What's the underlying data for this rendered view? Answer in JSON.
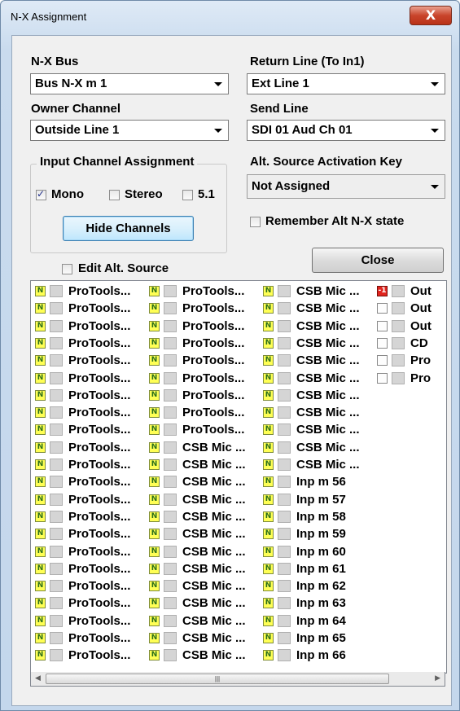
{
  "window": {
    "title": "N-X Assignment",
    "close_glyph": "X"
  },
  "nx_bus": {
    "label": "N-X Bus",
    "value": "Bus N-X m  1"
  },
  "owner_channel": {
    "label": "Owner Channel",
    "value": "Outside Line 1"
  },
  "return_line": {
    "label": "Return Line (To In1)",
    "value": "Ext Line 1"
  },
  "send_line": {
    "label": "Send Line",
    "value": "SDI 01 Aud Ch 01"
  },
  "input_assignment": {
    "title": "Input Channel Assignment",
    "mono": "Mono",
    "mono_checked": true,
    "stereo": "Stereo",
    "stereo_checked": false,
    "surround": "5.1",
    "surround_checked": false,
    "hide_button": "Hide Channels"
  },
  "alt_source_key": {
    "label": "Alt. Source Activation Key",
    "value": "Not Assigned"
  },
  "remember_alt": {
    "label": "Remember Alt N-X state",
    "checked": false
  },
  "edit_alt_source": {
    "label": "Edit Alt. Source",
    "checked": false
  },
  "close_button": "Close",
  "badge_n": "N",
  "badge_r": "-1",
  "channel_columns": [
    {
      "items": [
        {
          "icon": "n",
          "text": "ProTools..."
        },
        {
          "icon": "n",
          "text": "ProTools..."
        },
        {
          "icon": "n",
          "text": "ProTools..."
        },
        {
          "icon": "n",
          "text": "ProTools..."
        },
        {
          "icon": "n",
          "text": "ProTools..."
        },
        {
          "icon": "n",
          "text": "ProTools..."
        },
        {
          "icon": "n",
          "text": "ProTools..."
        },
        {
          "icon": "n",
          "text": "ProTools..."
        },
        {
          "icon": "n",
          "text": "ProTools..."
        },
        {
          "icon": "n",
          "text": "ProTools..."
        },
        {
          "icon": "n",
          "text": "ProTools..."
        },
        {
          "icon": "n",
          "text": "ProTools..."
        },
        {
          "icon": "n",
          "text": "ProTools..."
        },
        {
          "icon": "n",
          "text": "ProTools..."
        },
        {
          "icon": "n",
          "text": "ProTools..."
        },
        {
          "icon": "n",
          "text": "ProTools..."
        },
        {
          "icon": "n",
          "text": "ProTools..."
        },
        {
          "icon": "n",
          "text": "ProTools..."
        },
        {
          "icon": "n",
          "text": "ProTools..."
        },
        {
          "icon": "n",
          "text": "ProTools..."
        },
        {
          "icon": "n",
          "text": "ProTools..."
        },
        {
          "icon": "n",
          "text": "ProTools..."
        }
      ]
    },
    {
      "items": [
        {
          "icon": "n",
          "text": "ProTools..."
        },
        {
          "icon": "n",
          "text": "ProTools..."
        },
        {
          "icon": "n",
          "text": "ProTools..."
        },
        {
          "icon": "n",
          "text": "ProTools..."
        },
        {
          "icon": "n",
          "text": "ProTools..."
        },
        {
          "icon": "n",
          "text": "ProTools..."
        },
        {
          "icon": "n",
          "text": "ProTools..."
        },
        {
          "icon": "n",
          "text": "ProTools..."
        },
        {
          "icon": "n",
          "text": "ProTools..."
        },
        {
          "icon": "n",
          "text": "CSB Mic ..."
        },
        {
          "icon": "n",
          "text": "CSB Mic ..."
        },
        {
          "icon": "n",
          "text": "CSB Mic ..."
        },
        {
          "icon": "n",
          "text": "CSB Mic ..."
        },
        {
          "icon": "n",
          "text": "CSB Mic ..."
        },
        {
          "icon": "n",
          "text": "CSB Mic ..."
        },
        {
          "icon": "n",
          "text": "CSB Mic ..."
        },
        {
          "icon": "n",
          "text": "CSB Mic ..."
        },
        {
          "icon": "n",
          "text": "CSB Mic ..."
        },
        {
          "icon": "n",
          "text": "CSB Mic ..."
        },
        {
          "icon": "n",
          "text": "CSB Mic ..."
        },
        {
          "icon": "n",
          "text": "CSB Mic ..."
        },
        {
          "icon": "n",
          "text": "CSB Mic ..."
        }
      ]
    },
    {
      "items": [
        {
          "icon": "n",
          "text": "CSB Mic ..."
        },
        {
          "icon": "n",
          "text": "CSB Mic ..."
        },
        {
          "icon": "n",
          "text": "CSB Mic ..."
        },
        {
          "icon": "n",
          "text": "CSB Mic ..."
        },
        {
          "icon": "n",
          "text": "CSB Mic ..."
        },
        {
          "icon": "n",
          "text": "CSB Mic ..."
        },
        {
          "icon": "n",
          "text": "CSB Mic ..."
        },
        {
          "icon": "n",
          "text": "CSB Mic ..."
        },
        {
          "icon": "n",
          "text": "CSB Mic ..."
        },
        {
          "icon": "n",
          "text": "CSB Mic ..."
        },
        {
          "icon": "n",
          "text": "CSB Mic ..."
        },
        {
          "icon": "n",
          "text": "Inp m 56"
        },
        {
          "icon": "n",
          "text": "Inp m 57"
        },
        {
          "icon": "n",
          "text": "Inp m 58"
        },
        {
          "icon": "n",
          "text": "Inp m 59"
        },
        {
          "icon": "n",
          "text": "Inp m 60"
        },
        {
          "icon": "n",
          "text": "Inp m 61"
        },
        {
          "icon": "n",
          "text": "Inp m 62"
        },
        {
          "icon": "n",
          "text": "Inp m 63"
        },
        {
          "icon": "n",
          "text": "Inp m 64"
        },
        {
          "icon": "n",
          "text": "Inp m 65"
        },
        {
          "icon": "n",
          "text": "Inp m 66"
        }
      ]
    },
    {
      "items": [
        {
          "icon": "r",
          "text": "Out"
        },
        {
          "icon": "b",
          "text": "Out"
        },
        {
          "icon": "b",
          "text": "Out"
        },
        {
          "icon": "b",
          "text": "CD"
        },
        {
          "icon": "b",
          "text": "Pro"
        },
        {
          "icon": "b",
          "text": "Pro"
        }
      ]
    }
  ]
}
